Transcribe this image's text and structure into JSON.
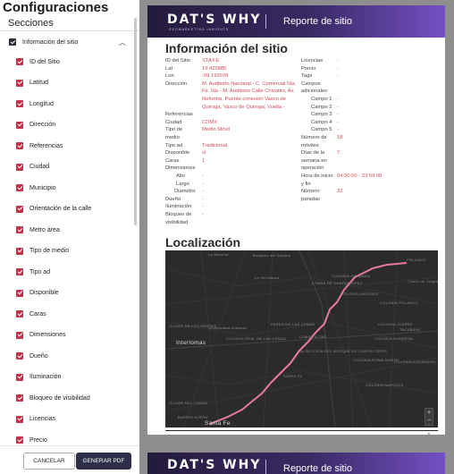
{
  "panel": {
    "title": "Configuraciones",
    "section_title": "Secciones",
    "group": {
      "label": "Información del sitio",
      "checked": true
    },
    "items": [
      "ID del Sitio",
      "Latitud",
      "Longitud",
      "Dirección",
      "Referencias",
      "Ciudad",
      "Municipio",
      "Orientación de la calle",
      "Metro área",
      "Tipo de medio",
      "Tipo ad",
      "Disponible",
      "Caras",
      "Dimensiones",
      "Dueño",
      "Iluminación",
      "Bloqueo de visibilidad",
      "Licencias",
      "Precio"
    ],
    "cancel_label": "CANCELAR",
    "generate_label": "GENERAR PDF"
  },
  "report": {
    "brand": "DAT'S WHY",
    "brand_sub": "GEOMARKETING INSIGHTS",
    "banner_title": "Reporte de sitio",
    "section1_title": "Información del sitio",
    "section2_title": "Localización",
    "page_number": "1",
    "left": [
      {
        "k": "ID del Sitio",
        "v": "STA FE"
      },
      {
        "k": "Lat",
        "v": "19.425885"
      },
      {
        "k": "Lon",
        "v": "-99.192078"
      },
      {
        "k": "Dirección",
        "v": "M. Auditorio Nacional - C. Comercial Sta."
      },
      {
        "k": "",
        "v": "Fe. Ida - M. Auditorio Calle Chivatito, Av."
      },
      {
        "k": "",
        "v": "Reforma, Puente conexión Vasco de"
      },
      {
        "k": "",
        "v": "Quiroga, Vasco de Quiroga, Vuelta -"
      },
      {
        "k": "Referencias",
        "v": ""
      },
      {
        "k": "Ciudad",
        "v": "CDMX"
      },
      {
        "k": "Tipo de",
        "v": "Medio Móvil"
      },
      {
        "k": "medio",
        "v": ""
      },
      {
        "k": "Tipo ad",
        "v": "Tradicional"
      },
      {
        "k": "Disponible",
        "v": "sí"
      },
      {
        "k": "Caras",
        "v": "1"
      },
      {
        "k": "Dimensiones",
        "v": ""
      },
      {
        "k": "Alto",
        "v": "-"
      },
      {
        "k": "Largo",
        "v": "-"
      },
      {
        "k": "Diametro",
        "v": "-"
      },
      {
        "k": "Dueño",
        "v": "-"
      },
      {
        "k": "Iluminación",
        "v": "-"
      },
      {
        "k": "Bloqueo de",
        "v": "-"
      },
      {
        "k": "visibilidad",
        "v": ""
      }
    ],
    "right": [
      {
        "k": "Licencias",
        "v": "-"
      },
      {
        "k": "Precio",
        "v": "-"
      },
      {
        "k": "Tags",
        "v": "-"
      },
      {
        "k": "Campos",
        "v": ""
      },
      {
        "k": "adicionales",
        "v": ""
      },
      {
        "k": "Campo 1",
        "v": "-"
      },
      {
        "k": "Campo 2",
        "v": "-"
      },
      {
        "k": "Campo 3",
        "v": "-"
      },
      {
        "k": "Campo 4",
        "v": "-"
      },
      {
        "k": "Campo 5",
        "v": "-"
      },
      {
        "k": "Número de",
        "v": "18"
      },
      {
        "k": "móviles",
        "v": ""
      },
      {
        "k": "Días de la",
        "v": "7"
      },
      {
        "k": "semana en",
        "v": ""
      },
      {
        "k": "operación",
        "v": ""
      },
      {
        "k": "Hora de inicio",
        "v": "04:30:00 - 23:59:00"
      },
      {
        "k": "y fin",
        "v": ""
      },
      {
        "k": "Número",
        "v": "32"
      },
      {
        "k": "paradas",
        "v": ""
      }
    ],
    "map_labels": [
      {
        "t": "La Mancha",
        "big": false
      },
      {
        "t": "Bosques del Castillo",
        "big": false
      },
      {
        "t": "La Herradura",
        "big": false
      },
      {
        "t": "POLANCO",
        "big": false
      },
      {
        "t": "Carso de Chapultepec",
        "big": false
      },
      {
        "t": "COLONIA GRANADA",
        "big": false
      },
      {
        "t": "LOMAS DE CHAPULTEPEC",
        "big": false
      },
      {
        "t": "COLONIA ANZURES",
        "big": false
      },
      {
        "t": "COLONIA POLANCO",
        "big": false
      },
      {
        "t": "OLIVAR DE LOS PADRES",
        "big": false
      },
      {
        "t": "Universidad Anáhuac",
        "big": false
      },
      {
        "t": "PASEO DE LAS LOMAS",
        "big": false
      },
      {
        "t": "Interlomas",
        "big": true
      },
      {
        "t": "COLONIA REAL DE LAS LOMAS",
        "big": false
      },
      {
        "t": "LOMAS ALTAS",
        "big": false
      },
      {
        "t": "1a SECCION DEL BOSQUE DE CHAPULTEPEC",
        "big": false
      },
      {
        "t": "COLONIA JUAREZ",
        "big": false
      },
      {
        "t": "COLONIA CONDESA",
        "big": false
      },
      {
        "t": "TACUBAYA",
        "big": false
      },
      {
        "t": "COLONIA ROMA NORTE",
        "big": false
      },
      {
        "t": "COLONIA ESCANDON",
        "big": false
      },
      {
        "t": "SANTA FE",
        "big": false
      },
      {
        "t": "COLONIA NAPOLES",
        "big": false
      },
      {
        "t": "Santa Fe",
        "big": true
      },
      {
        "t": "OLIVAR DEL CONDE",
        "big": false
      },
      {
        "t": "BARRIO NORTE",
        "big": false
      }
    ]
  },
  "colors": {
    "checkbox": "#c0334a",
    "banner_start": "#231b3c",
    "banner_end": "#7450c4",
    "value_text": "#d14a5a",
    "map_bg": "#2b2b2d",
    "route": "#e87a9a"
  }
}
